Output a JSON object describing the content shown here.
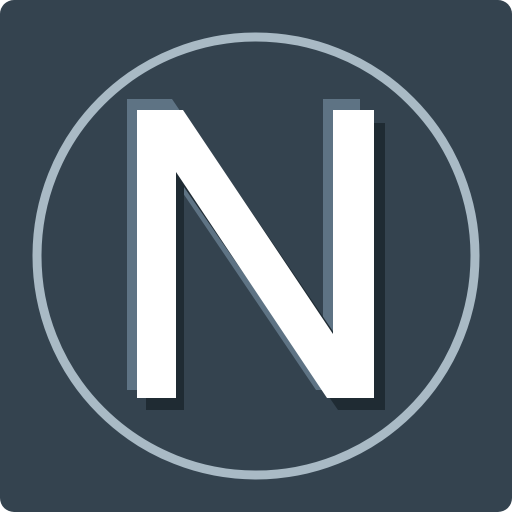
{
  "logo": {
    "letter": "N",
    "name": "n-letter-logo",
    "colors": {
      "background": "#34434F",
      "ring": "#A9BAC5",
      "letter": "#FFFFFF",
      "shadow_light": "#5E7384",
      "shadow_dark": "#1F2B33"
    }
  }
}
